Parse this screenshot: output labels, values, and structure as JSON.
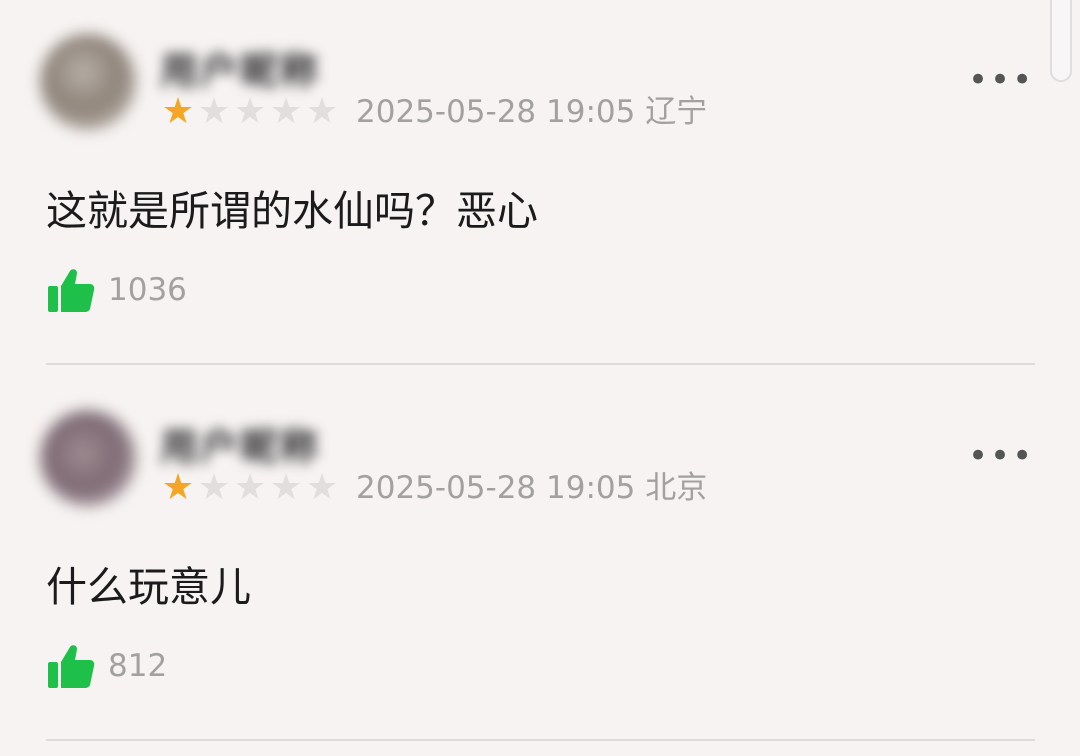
{
  "comments": [
    {
      "username": "用户昵称",
      "rating": 1,
      "rating_max": 5,
      "date": "2025-05-28 19:05",
      "location": "辽宁",
      "text": "这就是所谓的水仙吗？恶心",
      "likes": "1036"
    },
    {
      "username": "用户昵称",
      "rating": 1,
      "rating_max": 5,
      "date": "2025-05-28 19:05",
      "location": "北京",
      "text": "什么玩意儿",
      "likes": "812"
    }
  ],
  "icons": {
    "more": "more-options-icon",
    "like": "thumbs-up-icon",
    "star": "star-icon"
  },
  "colors": {
    "background": "#f6f3f2",
    "star_filled": "#f5a623",
    "star_empty": "#e2dedd",
    "like_green": "#1ec04a",
    "meta_gray": "#a3a0a0"
  }
}
